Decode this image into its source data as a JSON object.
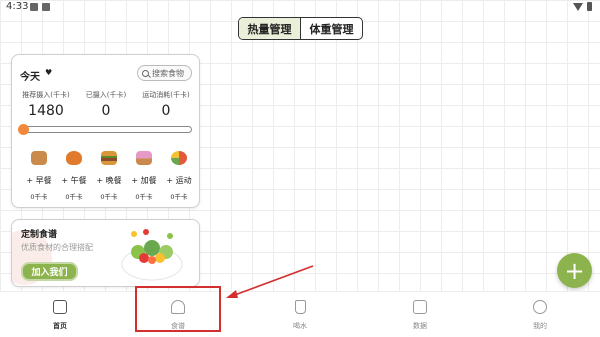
{
  "status_bar": {
    "time": "4:33"
  },
  "segments": {
    "calorie": "热量管理",
    "weight": "体重管理"
  },
  "today": {
    "label": "今天",
    "search_placeholder": "搜索食物",
    "stats": [
      {
        "label": "推荐摄入(千卡)",
        "value": "1480"
      },
      {
        "label": "已摄入(千卡)",
        "value": "0"
      },
      {
        "label": "运动消耗(千卡)",
        "value": "0"
      }
    ],
    "progress": 0,
    "meals": [
      {
        "icon": "bread-icon",
        "label": "+ 早餐",
        "kcal": "0千卡",
        "color": "#c98a4b"
      },
      {
        "icon": "chicken-icon",
        "label": "+ 午餐",
        "kcal": "0千卡",
        "color": "#e07a2d"
      },
      {
        "icon": "burger-icon",
        "label": "+ 晚餐",
        "kcal": "0千卡",
        "color": "#d9963a"
      },
      {
        "icon": "cupcake-icon",
        "label": "+ 加餐",
        "kcal": "0千卡",
        "color": "#e59ac6"
      },
      {
        "icon": "exercise-ball-icon",
        "label": "+ 运动",
        "kcal": "0千卡",
        "color": "#e25a3a"
      }
    ]
  },
  "recipe": {
    "title": "定制食谱",
    "subtitle": "优质食材的合理搭配",
    "button": "加入我们"
  },
  "fab": {
    "symbol": "+",
    "color": "#8db34e"
  },
  "tabbar": [
    {
      "icon": "home-icon",
      "label": "首页",
      "active": true
    },
    {
      "icon": "recipe-icon",
      "label": "食谱",
      "active": false
    },
    {
      "icon": "water-cup-icon",
      "label": "喝水",
      "active": false
    },
    {
      "icon": "data-chart-icon",
      "label": "数据",
      "active": false
    },
    {
      "icon": "profile-icon",
      "label": "我的",
      "active": false
    }
  ],
  "accent_color": "#8db34e",
  "annotation_color": "#d32f2f"
}
